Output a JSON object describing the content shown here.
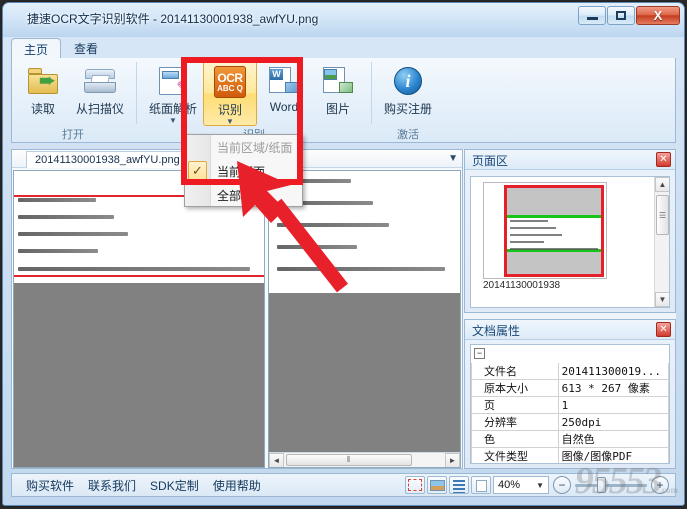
{
  "window": {
    "title": "捷速OCR文字识别软件 - 20141130001938_awfYU.png",
    "minimize": "—",
    "maximize": "❐",
    "close": "X"
  },
  "ribbon": {
    "tabs": [
      {
        "label": "主页",
        "active": true
      },
      {
        "label": "查看",
        "active": false
      }
    ],
    "groups": [
      {
        "label": "打开",
        "buttons": [
          {
            "label": "读取",
            "icon": "folder-open-icon"
          },
          {
            "label": "从扫描仪",
            "icon": "scanner-icon"
          }
        ]
      },
      {
        "label": "识别",
        "buttons": [
          {
            "label": "纸面解析",
            "icon": "page-analyze-icon",
            "arrow": "▼"
          },
          {
            "label": "识别",
            "icon": "ocr-icon",
            "arrow": "▼",
            "selected": true
          },
          {
            "label": "Word",
            "icon": "word-icon"
          },
          {
            "label": "图片",
            "icon": "image-icon"
          }
        ]
      },
      {
        "label": "激活",
        "buttons": [
          {
            "label": "购买注册",
            "icon": "info-icon"
          }
        ]
      }
    ]
  },
  "dropdown_menu": {
    "items": [
      {
        "label": "当前区域/纸面",
        "checked": false,
        "disabled": true
      },
      {
        "label": "当前页面",
        "checked": true,
        "disabled": false
      },
      {
        "label": "全部",
        "checked": false,
        "disabled": false
      }
    ],
    "check_glyph": "✓"
  },
  "document": {
    "tab_label": "20141130001938_awfYU.png",
    "tab_dropdown": "▼",
    "scroll_left_arrow": "◄",
    "scroll_right_arrow": "►",
    "scroll_grip": "⦀"
  },
  "pages_panel": {
    "title": "页面区",
    "close": "✕",
    "thumbnail_caption": "20141130001938",
    "scroll_up": "▲",
    "scroll_down": "▼",
    "scroll_grip": "☰"
  },
  "properties_panel": {
    "title": "文档属性",
    "close": "✕",
    "expander": "−",
    "rows": [
      {
        "key": "文件名",
        "value": "201411300019..."
      },
      {
        "key": "原本大小",
        "value": "613 * 267 像素"
      },
      {
        "key": "页",
        "value": "1"
      },
      {
        "key": "分辨率",
        "value": "250dpi"
      },
      {
        "key": "色",
        "value": "自然色"
      },
      {
        "key": "文件类型",
        "value": "图像/图像PDF"
      }
    ]
  },
  "statusbar": {
    "links": [
      "购买软件",
      "联系我们",
      "SDK定制",
      "使用帮助"
    ],
    "view_buttons": [
      "select-region-view-icon",
      "thumbnail-view-icon",
      "text-list-view-icon",
      "single-page-view-icon"
    ],
    "zoom_value": "40%",
    "zoom_dropdown": "▼",
    "zoom_out": "−",
    "zoom_in": "+"
  },
  "watermark": {
    "text": "95553",
    "sub": ".com"
  }
}
